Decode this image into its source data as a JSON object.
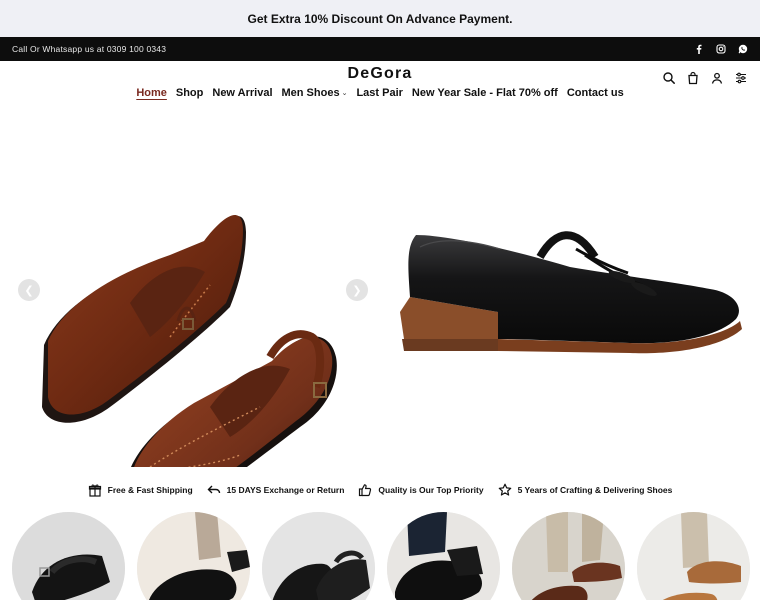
{
  "promo": {
    "text": "Get Extra 10% Discount On Advance Payment."
  },
  "topbar": {
    "contact": "Call Or Whatsapp us at 0309 100 0343",
    "socials": [
      "facebook-icon",
      "instagram-icon",
      "whatsapp-icon"
    ]
  },
  "header": {
    "logo": "DeGora",
    "icons": [
      "search-icon",
      "bag-icon",
      "user-icon",
      "filter-icon"
    ]
  },
  "nav": {
    "items": [
      {
        "label": "Home",
        "active": true
      },
      {
        "label": "Shop"
      },
      {
        "label": "New Arrival"
      },
      {
        "label": "Men Shoes",
        "dropdown": true
      },
      {
        "label": "Last Pair"
      },
      {
        "label": "New Year Sale - Flat 70% off"
      },
      {
        "label": "Contact us"
      }
    ]
  },
  "hero": {
    "slides": [
      "brown-peshawari-sandals",
      "black-tassel-loafer"
    ],
    "prev_icon": "chevron-left-icon",
    "next_icon": "chevron-right-icon"
  },
  "features": [
    {
      "icon": "gift-icon",
      "label": "Free & Fast Shipping"
    },
    {
      "icon": "return-icon",
      "label": "15 DAYS Exchange or Return"
    },
    {
      "icon": "thumbs-up-icon",
      "label": "Quality is Our Top Priority"
    },
    {
      "icon": "star-icon",
      "label": "5 Years of Crafting & Delivering Shoes"
    }
  ],
  "categories": [
    "black-sandal",
    "black-slip-on",
    "black-peshawari",
    "black-loafer",
    "brown-sandal",
    "tan-sandal"
  ],
  "colors": {
    "topbar": "#0d0d0d",
    "promo_bg": "#eff0f5",
    "active_nav": "#7a2a20"
  }
}
